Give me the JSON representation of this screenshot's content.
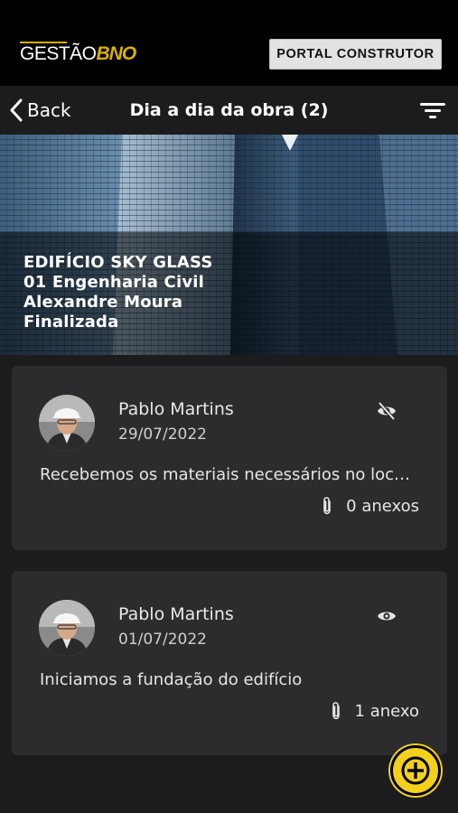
{
  "header": {
    "logo": {
      "brand_white": "GESTÃO",
      "brand_gold": "BNO"
    },
    "portal_button_label": "PORTAL CONSTRUTOR"
  },
  "nav": {
    "back_label": "Back",
    "title": "Dia a dia da obra (2)"
  },
  "project": {
    "name": "EDIFÍCIO SKY GLASS",
    "discipline": "01 Engenharia Civil",
    "responsible": "Alexandre Moura",
    "status": "Finalizada"
  },
  "entries": [
    {
      "author": "Pablo Martins",
      "date": "29/07/2022",
      "message": "Recebemos os materiais necessários no local da obra",
      "attachments": "0 anexos",
      "visibility_icon": "eye-off-icon"
    },
    {
      "author": "Pablo Martins",
      "date": "01/07/2022",
      "message": "Iniciamos a fundação do edifício",
      "attachments": "1 anexo",
      "visibility_icon": "eye-icon"
    }
  ],
  "colors": {
    "accent": "#f2d11c",
    "background": "#1c1c1e",
    "card": "#2c2c2e"
  }
}
